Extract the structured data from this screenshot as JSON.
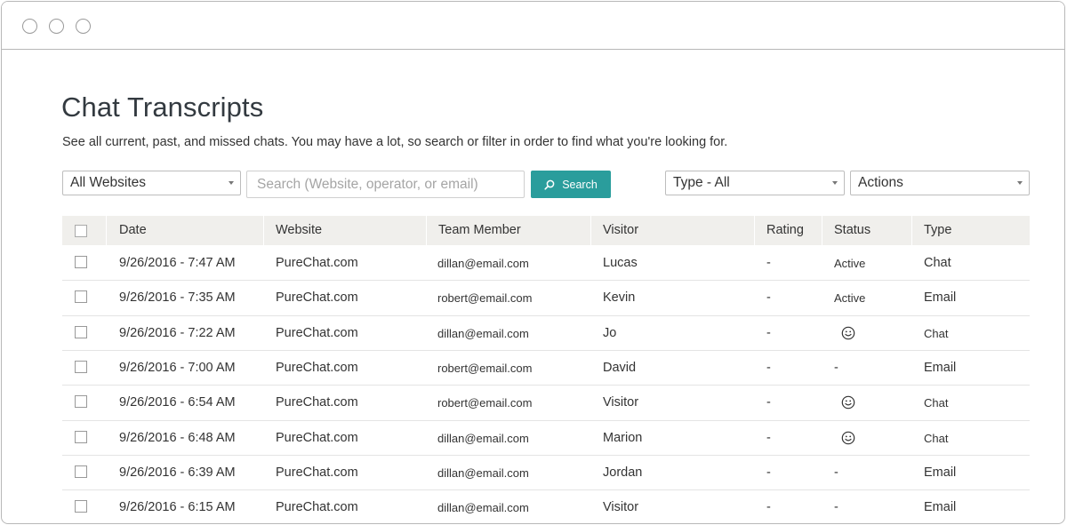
{
  "header": {
    "title": "Chat Transcripts",
    "subtitle": "See all current, past, and missed chats. You may have a lot, so search or filter in order to find what you're looking for."
  },
  "filters": {
    "website_select": "All Websites",
    "search_placeholder": "Search (Website, operator, or email)",
    "search_button": "Search",
    "type_select": "Type - All",
    "actions_select": "Actions"
  },
  "table": {
    "columns": [
      "Date",
      "Website",
      "Team Member",
      "Visitor",
      "Rating",
      "Status",
      "Type"
    ],
    "rows": [
      {
        "date": "9/26/2016 - 7:47 AM",
        "website": "PureChat.com",
        "member": "dillan@email.com",
        "visitor": "Lucas",
        "rating": "-",
        "status": "Active",
        "status_icon": "",
        "type": "Chat"
      },
      {
        "date": "9/26/2016 - 7:35 AM",
        "website": "PureChat.com",
        "member": "robert@email.com",
        "visitor": "Kevin",
        "rating": "-",
        "status": "Active",
        "status_icon": "",
        "type": "Email"
      },
      {
        "date": "9/26/2016 - 7:22 AM",
        "website": "PureChat.com",
        "member": "dillan@email.com",
        "visitor": "Jo",
        "rating": "-",
        "status": "",
        "status_icon": "smiley-icon",
        "type": "Chat"
      },
      {
        "date": "9/26/2016 - 7:00 AM",
        "website": "PureChat.com",
        "member": "robert@email.com",
        "visitor": "David",
        "rating": "-",
        "status": "-",
        "status_icon": "",
        "type": "Email"
      },
      {
        "date": "9/26/2016 - 6:54 AM",
        "website": "PureChat.com",
        "member": "robert@email.com",
        "visitor": "Visitor",
        "rating": "-",
        "status": "",
        "status_icon": "smiley-icon",
        "type": "Chat"
      },
      {
        "date": "9/26/2016 - 6:48 AM",
        "website": "PureChat.com",
        "member": "dillan@email.com",
        "visitor": "Marion",
        "rating": "-",
        "status": "",
        "status_icon": "smiley-icon",
        "type": "Chat"
      },
      {
        "date": "9/26/2016 - 6:39 AM",
        "website": "PureChat.com",
        "member": "dillan@email.com",
        "visitor": "Jordan",
        "rating": "-",
        "status": "-",
        "status_icon": "",
        "type": "Email"
      },
      {
        "date": "9/26/2016 - 6:15 AM",
        "website": "PureChat.com",
        "member": "dillan@email.com",
        "visitor": "Visitor",
        "rating": "-",
        "status": "-",
        "status_icon": "",
        "type": "Email"
      }
    ]
  },
  "colors": {
    "accent": "#2a9d9c",
    "header_bg": "#f0efec",
    "border": "#b8b8b8"
  }
}
